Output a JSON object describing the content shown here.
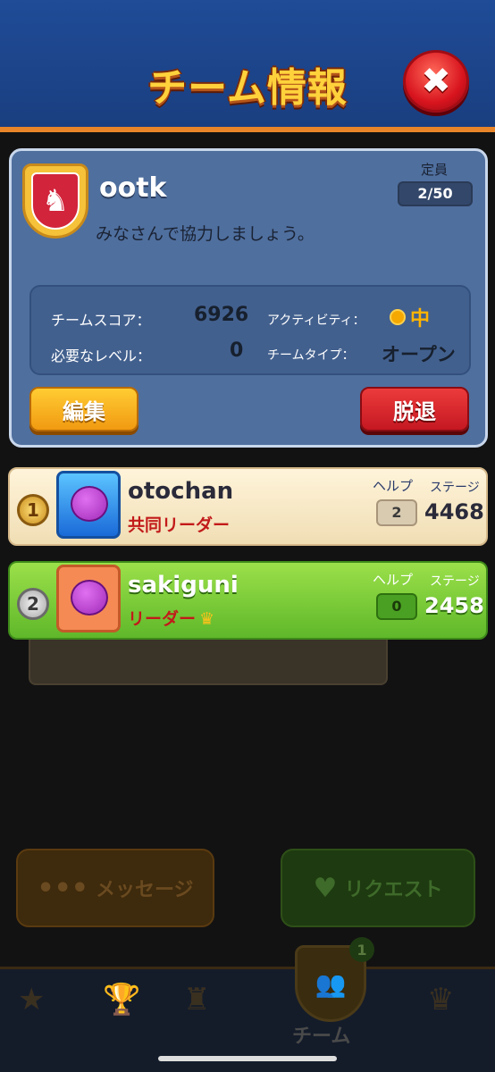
{
  "header": {
    "title": "チーム情報",
    "close_icon": "close-icon"
  },
  "team": {
    "name": "ootk",
    "description": "みなさんで協力しましょう。",
    "capacity_label": "定員",
    "capacity_value": "2/50",
    "emblem_icon": "rocking-horse-icon",
    "stats": {
      "score_label": "チームスコア：",
      "score_value": "6926",
      "level_label": "必要なレベル：",
      "level_value": "0",
      "activity_label": "アクティビティ：",
      "activity_value": "中",
      "type_label": "チームタイプ：",
      "type_value": "オープン"
    },
    "edit_label": "編集",
    "leave_label": "脱退"
  },
  "members": [
    {
      "rank": "1",
      "name": "otochan",
      "role": "共同リーダー",
      "help_label": "ヘルプ",
      "stage_label": "ステージ",
      "help": "2",
      "stage": "4468"
    },
    {
      "rank": "2",
      "name": "sakiguni",
      "role": "リーダー",
      "help_label": "ヘルプ",
      "stage_label": "ステージ",
      "help": "0",
      "stage": "2458"
    }
  ],
  "background": {
    "message_label": "メッセージ",
    "request_label": "リクエスト",
    "nav_team_label": "チーム",
    "nav_badge": "1"
  },
  "colors": {
    "header_bg": "#1f4b97",
    "card_bg": "#4f6f9e",
    "edit_btn": "#f5a91a",
    "leave_btn": "#d51f28",
    "activity": "#ffb400"
  }
}
